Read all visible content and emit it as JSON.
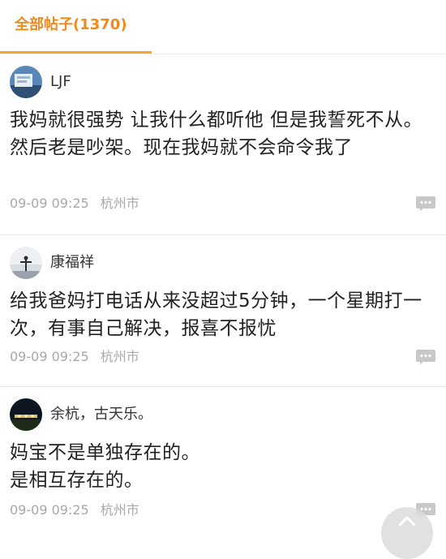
{
  "tab": {
    "label": "全部帖子(1370)"
  },
  "posts": [
    {
      "username": "LJF",
      "content_lines": [
        "我妈就很强势 让我什么都听他 但是我誓死不从。然后老是吵架。现在我妈就不会命令我了"
      ],
      "date": "09-09 09:25",
      "location": "杭州市"
    },
    {
      "username": "康福祥",
      "content_lines": [
        "给我爸妈打电话从来没超过5分钟，一个星期打一次，有事自己解决，报喜不报忧"
      ],
      "date": "09-09 09:25",
      "location": "杭州市"
    },
    {
      "username": "余杭，古天乐。",
      "content_lines": [
        "妈宝不是单独存在的。",
        "是相互存在的。"
      ],
      "date": "09-09 09:25",
      "location": "杭州市"
    }
  ],
  "colors": {
    "accent": "#f08a1c",
    "meta_text": "#a8a8a8",
    "icon": "#c8c8c8"
  },
  "icons": {
    "comment": "speech-bubble-icon"
  }
}
